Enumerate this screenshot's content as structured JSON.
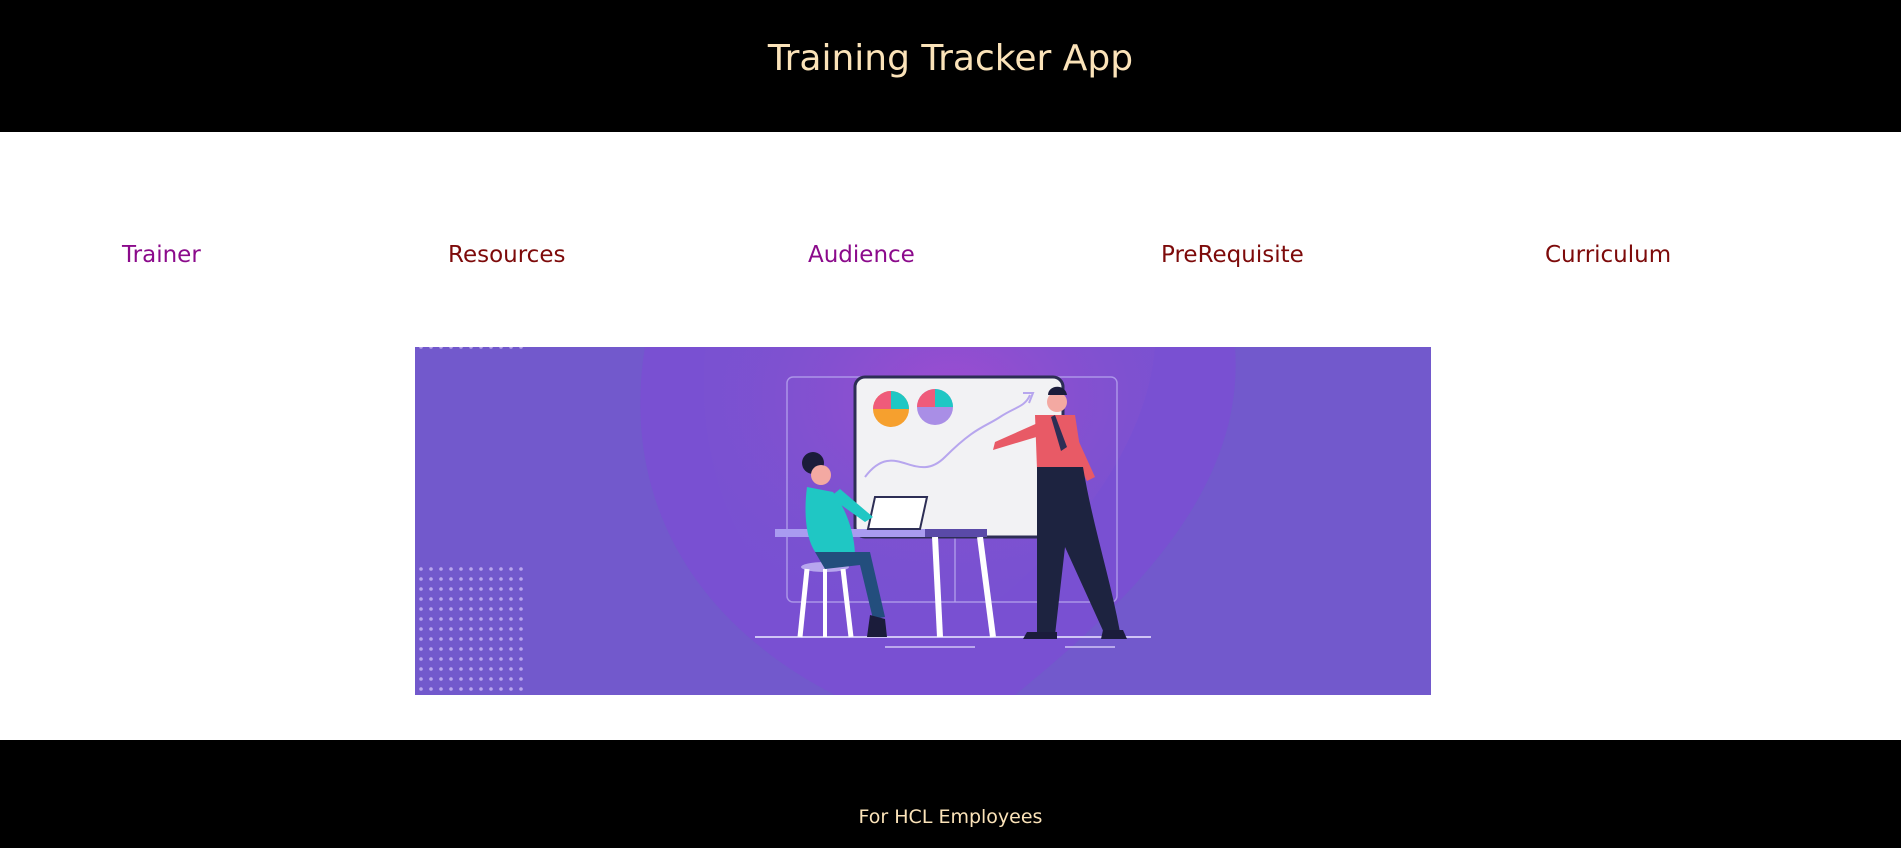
{
  "header": {
    "title": "Training Tracker App"
  },
  "nav": {
    "items": [
      {
        "label": "Trainer"
      },
      {
        "label": "Resources"
      },
      {
        "label": "Audience"
      },
      {
        "label": "PreRequisite"
      },
      {
        "label": "Curriculum"
      }
    ]
  },
  "banner": {
    "illustration": "presentation-illustration",
    "background_color": "#7259cc"
  },
  "footer": {
    "text": "For HCL Employees"
  },
  "colors": {
    "header_bg": "#000000",
    "header_text": "#fbe3b9",
    "nav_purple": "#8b0a8b",
    "nav_maroon": "#7d0a0a"
  }
}
